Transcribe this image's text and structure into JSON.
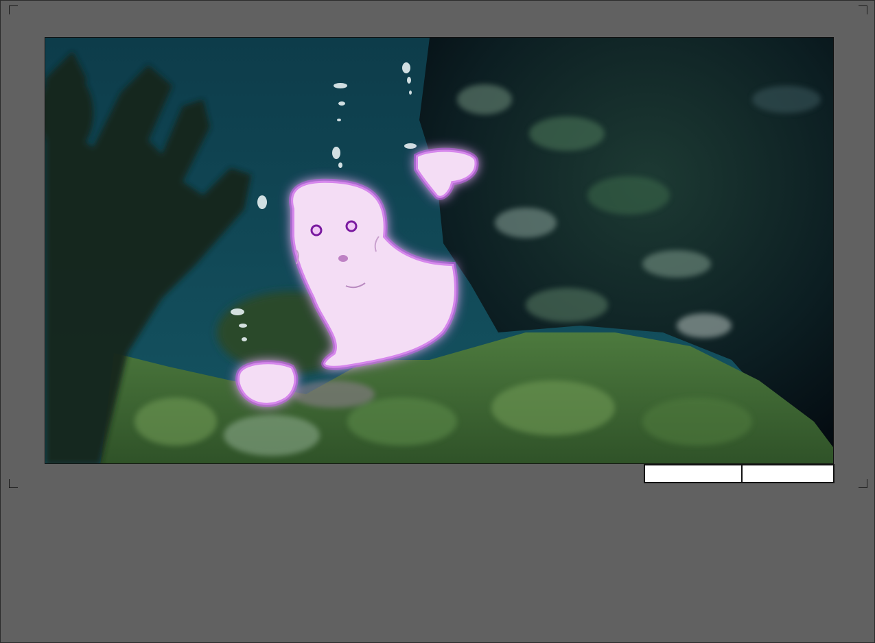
{
  "scene": {
    "name": "underwater-ghost-scene",
    "colors": {
      "water": "#0f4450",
      "water_deep": "#0a2f3a",
      "rock_dark": "#05121c",
      "moss": "#3f6a34",
      "moss_light": "#6f9a55",
      "kelp": "#18241a",
      "ghost_body": "#f3dcf4",
      "ghost_glow": "#c040e0",
      "ghost_eyes": "#7a1aa0",
      "bubble": "#e8f2f4"
    }
  },
  "bottom_bar": {
    "left_slot_label": "",
    "right_slot_label": ""
  }
}
